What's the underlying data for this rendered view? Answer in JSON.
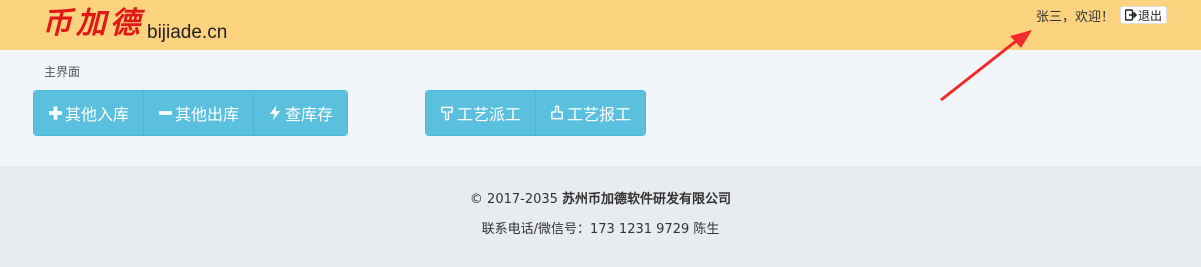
{
  "header": {
    "logo_cn": "币加德",
    "logo_en": "bijiade.cn",
    "greeting": "张三，欢迎！",
    "logout_label": "退出"
  },
  "breadcrumb": "主界面",
  "stock_buttons": [
    {
      "label": "其他入库",
      "icon": "plus-icon"
    },
    {
      "label": "其他出库",
      "icon": "minus-icon"
    },
    {
      "label": "查库存",
      "icon": "bolt-icon"
    }
  ],
  "process_buttons": [
    {
      "label": "工艺派工",
      "icon": "hand-point-down-icon"
    },
    {
      "label": "工艺报工",
      "icon": "hand-point-up-icon"
    }
  ],
  "footer": {
    "copyright_prefix": "© 2017-2035 ",
    "company": "苏州币加德软件研发有限公司",
    "contact": "联系电话/微信号：173 1231 9729 陈生"
  },
  "colors": {
    "header_bg": "#fbd37f",
    "logo_red": "#e01818",
    "button_bg": "#5bc0de",
    "annotation_arrow": "#f22a2a"
  }
}
